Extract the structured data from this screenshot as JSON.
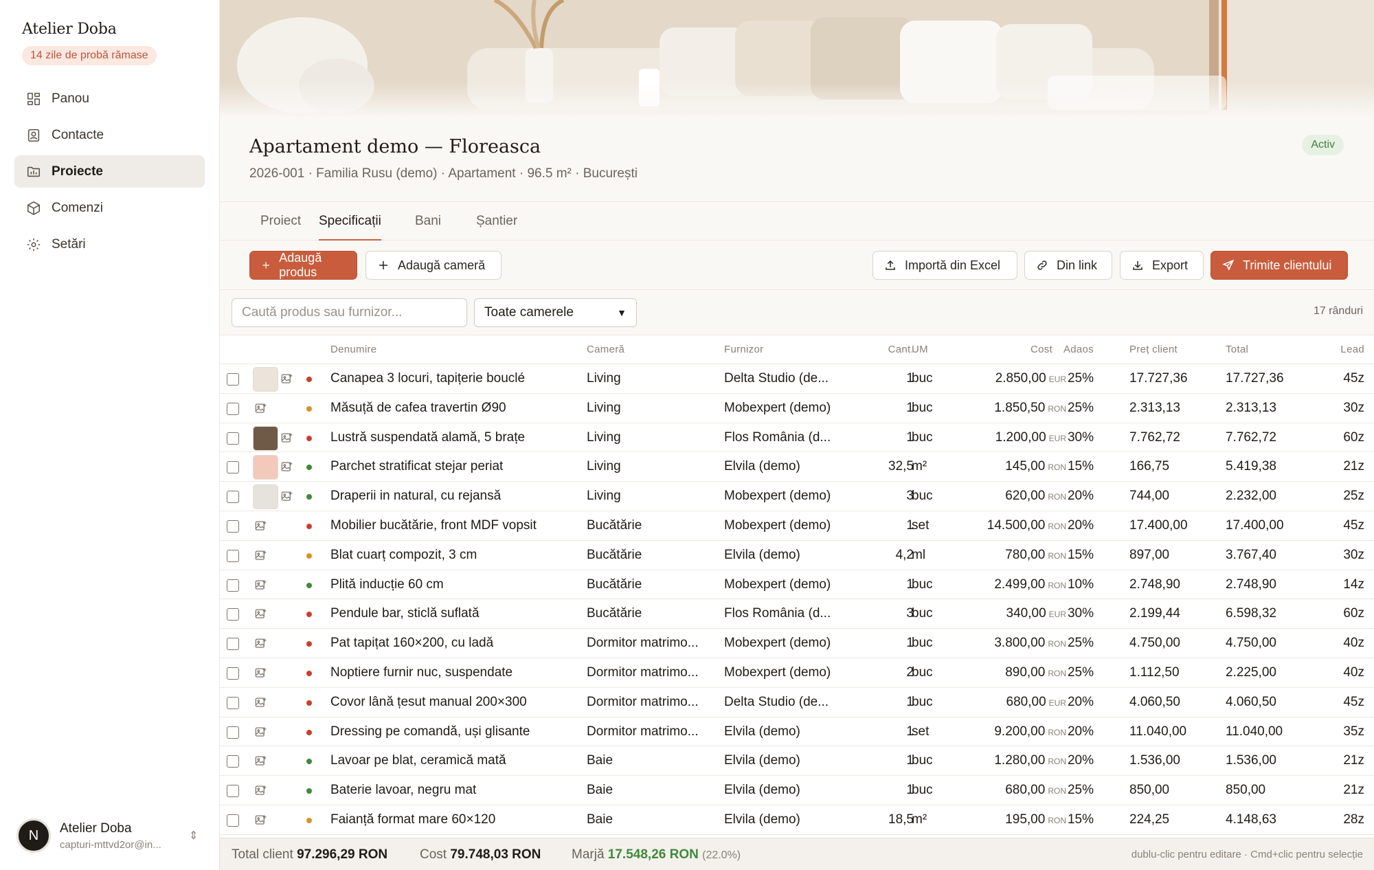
{
  "sidebar": {
    "brand": "Atelier Doba",
    "trial_badge": "14 zile de probă rămase",
    "items": [
      {
        "label": "Panou",
        "icon": "dashboard-icon"
      },
      {
        "label": "Contacte",
        "icon": "contacts-icon"
      },
      {
        "label": "Proiecte",
        "icon": "folder-icon",
        "active": true
      },
      {
        "label": "Comenzi",
        "icon": "package-icon"
      },
      {
        "label": "Setări",
        "icon": "gear-icon"
      }
    ],
    "user": {
      "initial": "N",
      "name": "Atelier Doba",
      "email": "capturi-mttvd2or@in..."
    }
  },
  "project": {
    "title": "Apartament demo — Floreasca",
    "subtitle": "2026-001 · Familia Rusu (demo) · Apartament · 96.5 m² · București",
    "status": "Activ"
  },
  "tabs": [
    {
      "label": "Proiect"
    },
    {
      "label": "Specificații",
      "active": true
    },
    {
      "label": "Bani"
    },
    {
      "label": "Șantier"
    }
  ],
  "toolbar": {
    "add_product": "Adaugă produs",
    "add_room": "Adaugă cameră",
    "import_excel": "Importă din Excel",
    "from_link": "Din link",
    "export": "Export",
    "send_client": "Trimite clientului"
  },
  "filters": {
    "search_placeholder": "Caută produs sau furnizor...",
    "room_select": "Toate camerele",
    "row_count": "17 rânduri"
  },
  "columns": {
    "name": "Denumire",
    "room": "Cameră",
    "supplier": "Furnizor",
    "qty": "Cant.",
    "unit": "UM",
    "cost": "Cost",
    "markup": "Adaos",
    "client_price": "Preț client",
    "total": "Total",
    "lead": "Lead"
  },
  "colors": {
    "status_red": "#c8402c",
    "status_amber": "#d9932b",
    "status_green": "#3f8a3a",
    "accent": "#c95c3c"
  },
  "rows": [
    {
      "thumb": "#ebe4da",
      "status": "red",
      "name": "Canapea 3 locuri, tapițerie bouclé",
      "room": "Living",
      "supplier": "Delta Studio (de...",
      "qty": "1",
      "unit": "buc",
      "cost": "2.850,00",
      "cur": "EUR",
      "markup": "25%",
      "price": "17.727,36",
      "total": "17.727,36",
      "lead": "45z"
    },
    {
      "thumb": "",
      "status": "amber",
      "name": "Măsuță de cafea travertin Ø90",
      "room": "Living",
      "supplier": "Mobexpert (demo)",
      "qty": "1",
      "unit": "buc",
      "cost": "1.850,50",
      "cur": "RON",
      "markup": "25%",
      "price": "2.313,13",
      "total": "2.313,13",
      "lead": "30z"
    },
    {
      "thumb": "#6e5a47",
      "status": "red",
      "name": "Lustră suspendată alamă, 5 brațe",
      "room": "Living",
      "supplier": "Flos România (d...",
      "qty": "1",
      "unit": "buc",
      "cost": "1.200,00",
      "cur": "EUR",
      "markup": "30%",
      "price": "7.762,72",
      "total": "7.762,72",
      "lead": "60z"
    },
    {
      "thumb": "#f2c9bb",
      "status": "green",
      "name": "Parchet stratificat stejar periat",
      "room": "Living",
      "supplier": "Elvila (demo)",
      "qty": "32,5",
      "unit": "m²",
      "cost": "145,00",
      "cur": "RON",
      "markup": "15%",
      "price": "166,75",
      "total": "5.419,38",
      "lead": "21z"
    },
    {
      "thumb": "#e6e2dc",
      "status": "green",
      "name": "Draperii in natural, cu rejansă",
      "room": "Living",
      "supplier": "Mobexpert (demo)",
      "qty": "3",
      "unit": "buc",
      "cost": "620,00",
      "cur": "RON",
      "markup": "20%",
      "price": "744,00",
      "total": "2.232,00",
      "lead": "25z"
    },
    {
      "thumb": "",
      "status": "red",
      "name": "Mobilier bucătărie, front MDF vopsit",
      "room": "Bucătărie",
      "supplier": "Mobexpert (demo)",
      "qty": "1",
      "unit": "set",
      "cost": "14.500,00",
      "cur": "RON",
      "markup": "20%",
      "price": "17.400,00",
      "total": "17.400,00",
      "lead": "45z"
    },
    {
      "thumb": "",
      "status": "amber",
      "name": "Blat cuarț compozit, 3 cm",
      "room": "Bucătărie",
      "supplier": "Elvila (demo)",
      "qty": "4,2",
      "unit": "ml",
      "cost": "780,00",
      "cur": "RON",
      "markup": "15%",
      "price": "897,00",
      "total": "3.767,40",
      "lead": "30z"
    },
    {
      "thumb": "",
      "status": "green",
      "name": "Plită inducție 60 cm",
      "room": "Bucătărie",
      "supplier": "Mobexpert (demo)",
      "qty": "1",
      "unit": "buc",
      "cost": "2.499,00",
      "cur": "RON",
      "markup": "10%",
      "price": "2.748,90",
      "total": "2.748,90",
      "lead": "14z"
    },
    {
      "thumb": "",
      "status": "red",
      "name": "Pendule bar, sticlă suflată",
      "room": "Bucătărie",
      "supplier": "Flos România (d...",
      "qty": "3",
      "unit": "buc",
      "cost": "340,00",
      "cur": "EUR",
      "markup": "30%",
      "price": "2.199,44",
      "total": "6.598,32",
      "lead": "60z"
    },
    {
      "thumb": "",
      "status": "red",
      "name": "Pat tapițat 160×200, cu ladă",
      "room": "Dormitor matrimo...",
      "supplier": "Mobexpert (demo)",
      "qty": "1",
      "unit": "buc",
      "cost": "3.800,00",
      "cur": "RON",
      "markup": "25%",
      "price": "4.750,00",
      "total": "4.750,00",
      "lead": "40z"
    },
    {
      "thumb": "",
      "status": "red",
      "name": "Noptiere furnir nuc, suspendate",
      "room": "Dormitor matrimo...",
      "supplier": "Mobexpert (demo)",
      "qty": "2",
      "unit": "buc",
      "cost": "890,00",
      "cur": "RON",
      "markup": "25%",
      "price": "1.112,50",
      "total": "2.225,00",
      "lead": "40z"
    },
    {
      "thumb": "",
      "status": "red",
      "name": "Covor lână țesut manual 200×300",
      "room": "Dormitor matrimo...",
      "supplier": "Delta Studio (de...",
      "qty": "1",
      "unit": "buc",
      "cost": "680,00",
      "cur": "EUR",
      "markup": "20%",
      "price": "4.060,50",
      "total": "4.060,50",
      "lead": "45z"
    },
    {
      "thumb": "",
      "status": "red",
      "name": "Dressing pe comandă, uși glisante",
      "room": "Dormitor matrimo...",
      "supplier": "Elvila (demo)",
      "qty": "1",
      "unit": "set",
      "cost": "9.200,00",
      "cur": "RON",
      "markup": "20%",
      "price": "11.040,00",
      "total": "11.040,00",
      "lead": "35z"
    },
    {
      "thumb": "",
      "status": "green",
      "name": "Lavoar pe blat, ceramică mată",
      "room": "Baie",
      "supplier": "Elvila (demo)",
      "qty": "1",
      "unit": "buc",
      "cost": "1.280,00",
      "cur": "RON",
      "markup": "20%",
      "price": "1.536,00",
      "total": "1.536,00",
      "lead": "21z"
    },
    {
      "thumb": "",
      "status": "green",
      "name": "Baterie lavoar, negru mat",
      "room": "Baie",
      "supplier": "Elvila (demo)",
      "qty": "1",
      "unit": "buc",
      "cost": "680,00",
      "cur": "RON",
      "markup": "25%",
      "price": "850,00",
      "total": "850,00",
      "lead": "21z"
    },
    {
      "thumb": "",
      "status": "amber",
      "name": "Faianță format mare 60×120",
      "room": "Baie",
      "supplier": "Elvila (demo)",
      "qty": "18,5",
      "unit": "m²",
      "cost": "195,00",
      "cur": "RON",
      "markup": "15%",
      "price": "224,25",
      "total": "4.148,63",
      "lead": "28z"
    }
  ],
  "footer": {
    "total_client_label": "Total client",
    "total_client": "97.296,29 RON",
    "cost_label": "Cost",
    "cost": "79.748,03 RON",
    "margin_label": "Marjă",
    "margin": "17.548,26 RON",
    "margin_pct": "(22.0%)",
    "hint": "dublu-clic pentru editare · Cmd+clic pentru selecție"
  }
}
